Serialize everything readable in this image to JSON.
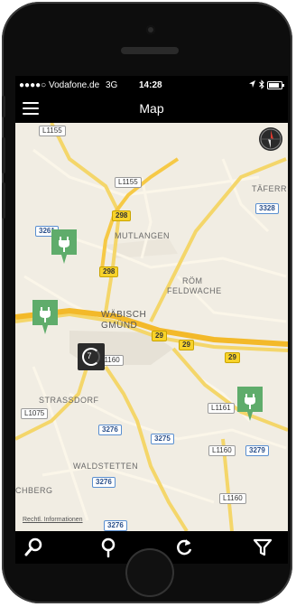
{
  "status_bar": {
    "carrier": "●●●●○ Vodafone.de",
    "network": "3G",
    "time": "14:28",
    "icons": [
      "location-arrow-icon",
      "bluetooth-icon",
      "battery-icon"
    ]
  },
  "nav": {
    "title": "Map",
    "menu_icon": "hamburger-menu-icon"
  },
  "map": {
    "place_names": [
      "MUTLANGEN",
      "RÖM",
      "FELDWACHE",
      "WÄBISCH",
      "GMÜND",
      "STRASSDORF",
      "WALDSTETTEN",
      "TÄFERR",
      "CHBERG"
    ],
    "road_labels": [
      "L1155",
      "L1155",
      "298",
      "298",
      "3328",
      "3261",
      "29",
      "29",
      "29",
      "L1160",
      "L1161",
      "L1075",
      "3276",
      "3275",
      "L1160",
      "3279",
      "3276",
      "L1160",
      "3276"
    ],
    "cluster_count": "7",
    "attribution": "Rechtl. Informationen",
    "accent_green": "#5fac6b",
    "compass_icon": "compass-icon",
    "pin_icon": "ev-charger-plug-icon"
  },
  "tab_bar": {
    "items": [
      "search-icon",
      "location-pin-icon",
      "refresh-icon",
      "filter-icon"
    ]
  }
}
